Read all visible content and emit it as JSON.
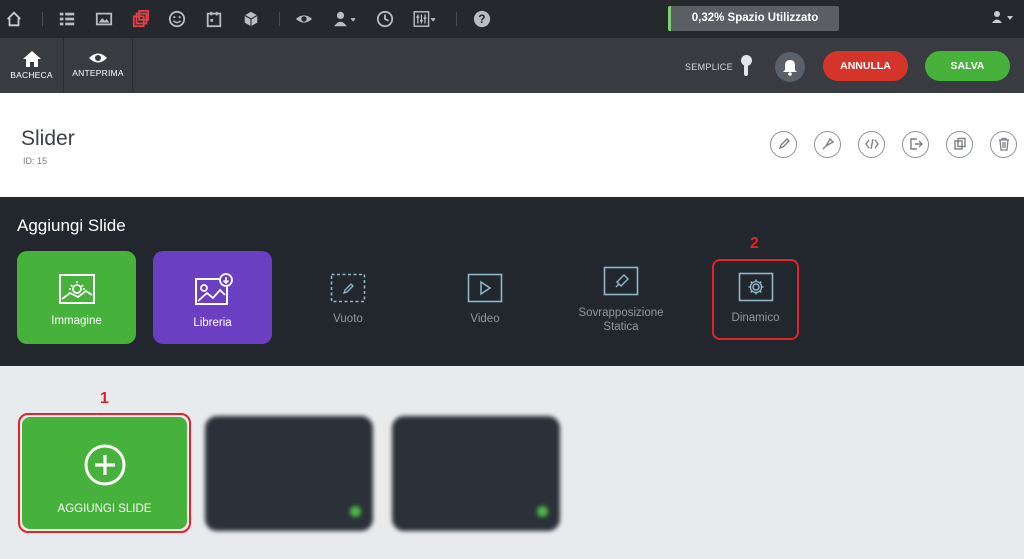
{
  "topbar": {
    "icons": [
      "home-icon",
      "list-icon",
      "image-icon",
      "layers-icon",
      "smiley-icon",
      "calendar-icon",
      "box-icon",
      "eye-icon",
      "user-admin-icon",
      "clock-icon",
      "sliders-icon",
      "help-icon"
    ],
    "usage_text": "0,32% Spazio Utilizzato",
    "usage_accent": "#7ad06e"
  },
  "toolbar2": {
    "dashboard_label": "BACHECA",
    "preview_label": "ANTEPRIMA",
    "mode_label": "SEMPLICE",
    "cancel_label": "ANNULLA",
    "save_label": "SALVA",
    "cancel_color": "#d5342b",
    "save_color": "#47b23b"
  },
  "header": {
    "title": "Slider",
    "id_text": "ID: 15",
    "actions": [
      "edit-icon",
      "brush-icon",
      "code-icon",
      "export-icon",
      "duplicate-icon",
      "trash-icon"
    ]
  },
  "add_section": {
    "title": "Aggiungi Slide",
    "tiles": [
      {
        "label": "Immagine",
        "icon": "image-icon",
        "color": "#47b23b"
      },
      {
        "label": "Libreria",
        "icon": "library-icon",
        "color": "#6a3fc2"
      },
      {
        "label": "Vuoto",
        "icon": "empty-icon"
      },
      {
        "label": "Video",
        "icon": "video-icon"
      },
      {
        "label": "Sovrapposizione Statica",
        "icon": "pin-icon"
      },
      {
        "label": "Dinamico",
        "icon": "gear-icon"
      }
    ],
    "marker_2": "2"
  },
  "slides": {
    "marker_1": "1",
    "add_label": "AGGIUNGI SLIDE"
  }
}
